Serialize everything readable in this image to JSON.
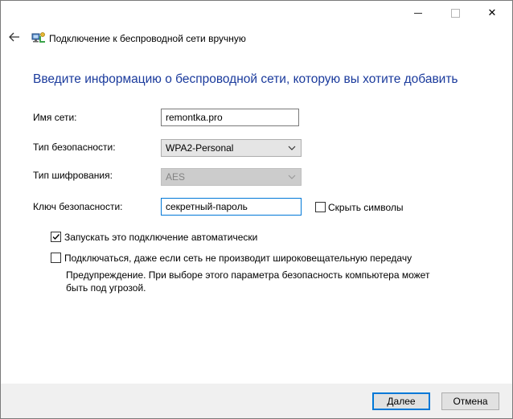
{
  "window": {
    "title": "Подключение к беспроводной сети вручную",
    "close_glyph": "✕"
  },
  "heading": "Введите информацию о беспроводной сети, которую вы хотите добавить",
  "form": {
    "network_name": {
      "label": "Имя сети:",
      "value": "remontka.pro"
    },
    "security_type": {
      "label": "Тип безопасности:",
      "value": "WPA2-Personal"
    },
    "encryption_type": {
      "label": "Тип шифрования:",
      "value": "AES",
      "disabled": true
    },
    "security_key": {
      "label": "Ключ безопасности:",
      "value": "секретный-пароль"
    },
    "hide_chars": {
      "label": "Скрыть символы",
      "checked": false
    }
  },
  "options": {
    "auto_connect": {
      "label": "Запускать это подключение автоматически",
      "checked": true
    },
    "connect_hidden": {
      "label": "Подключаться, даже если сеть не производит широковещательную передачу",
      "checked": false
    }
  },
  "warning": "Предупреждение. При выборе этого параметра безопасность компьютера может быть под угрозой.",
  "buttons": {
    "next": "Далее",
    "cancel": "Отмена"
  },
  "colors": {
    "heading": "#1a3a9c",
    "focus": "#0078d7",
    "footer": "#f0f0f0"
  },
  "icons": {
    "back": "arrow-left-icon",
    "title": "network-icon",
    "dropdown": "chevron-down-icon",
    "check": "checkmark-icon"
  }
}
